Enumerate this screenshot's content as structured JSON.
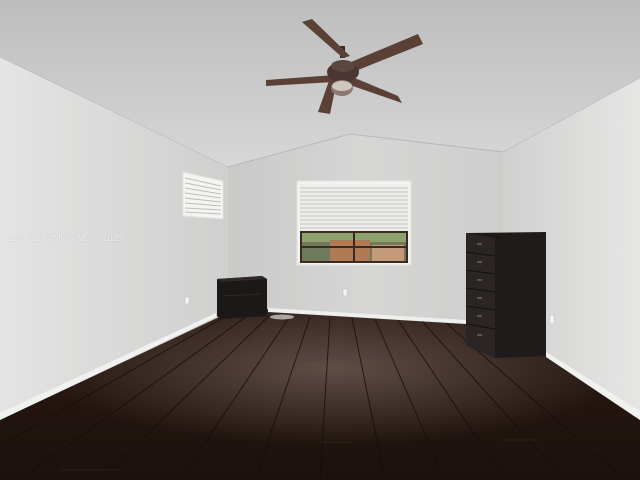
{
  "photo": {
    "watermark": "A11806325 © Miami MLS® 2025",
    "objects": [
      "vaulted-ceiling",
      "ceiling-fan-icon",
      "blinds-window",
      "small-window",
      "dark-dresser",
      "small-cabinet",
      "hardwood-floor"
    ]
  },
  "colors": {
    "ceiling": "#c8c9c8",
    "wall_left": "#d9d9d8",
    "wall_back": "#d0d0cf",
    "wall_right": "#dedfde",
    "floor": "#2a1a14",
    "baseboard": "#f2f2f0",
    "furniture": "#1f1b1b"
  }
}
